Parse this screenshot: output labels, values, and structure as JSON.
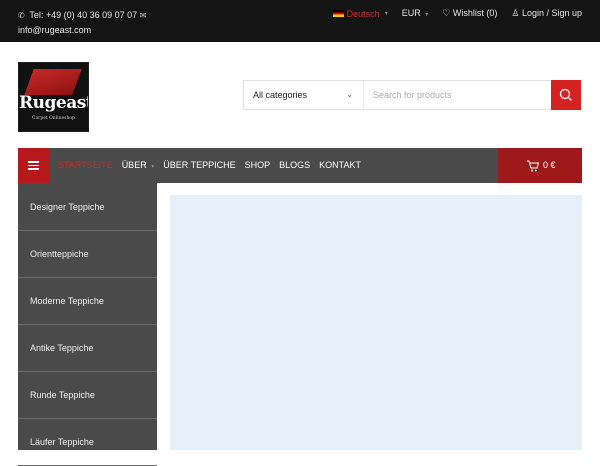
{
  "topbar": {
    "phone": "Tel: +49 (0) 40 36 09 07 07",
    "email": "info@rugeast.com",
    "language": "Deutsch",
    "currency": "EUR",
    "wishlist": "Wishlist (0)",
    "account": "Login / Sign up"
  },
  "logo": {
    "word": "Rugeast",
    "tagline": "Carpet Onlineshop"
  },
  "search": {
    "category": "All categories",
    "placeholder": "Search for products"
  },
  "nav": {
    "items": [
      "STARTSEITE",
      "ÜBER",
      "ÜBER TEPPICHE",
      "SHOP",
      "BLOGS",
      "KONTAKT"
    ],
    "cart_total": "0 €"
  },
  "sidebar": {
    "items": [
      "Designer Teppiche",
      "Orientteppiche",
      "Moderne Teppiche",
      "Antike Teppiche",
      "Runde Teppiche",
      "Läufer Teppiche"
    ]
  },
  "colors": {
    "accent": "#d52222",
    "dark": "#141414",
    "nav": "#4a4a4a",
    "banner": "#e5f1fa"
  },
  "icons": [
    "phone-icon",
    "mail-icon",
    "heart-icon",
    "user-icon",
    "search-icon",
    "menu-icon",
    "cart-icon",
    "chevron-down-icon",
    "flag-de-icon"
  ]
}
